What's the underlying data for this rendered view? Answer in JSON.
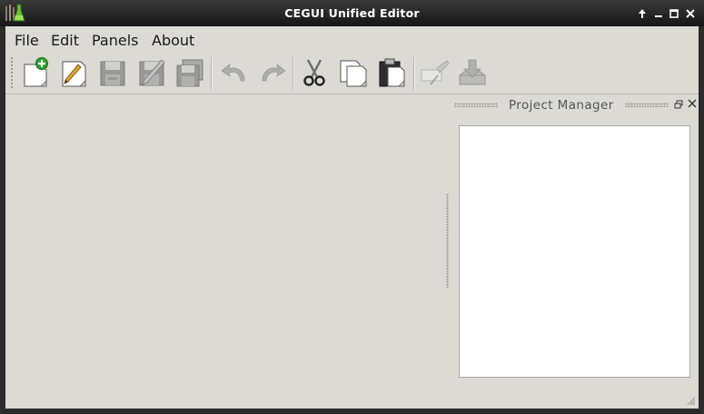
{
  "window": {
    "title": "CEGUI Unified Editor"
  },
  "menubar": {
    "items": [
      "File",
      "Edit",
      "Panels",
      "About"
    ]
  },
  "toolbar": {
    "buttons": [
      {
        "icon": "new-file-icon",
        "enabled": true
      },
      {
        "icon": "edit-document-icon",
        "enabled": true
      },
      {
        "icon": "save-icon",
        "enabled": false
      },
      {
        "icon": "save-as-icon",
        "enabled": false
      },
      {
        "icon": "save-all-icon",
        "enabled": false
      },
      {
        "icon": "undo-icon",
        "enabled": false
      },
      {
        "icon": "redo-icon",
        "enabled": false
      },
      {
        "icon": "cut-icon",
        "enabled": true
      },
      {
        "icon": "copy-icon",
        "enabled": true
      },
      {
        "icon": "paste-icon",
        "enabled": true
      },
      {
        "icon": "project-settings-icon",
        "enabled": false
      },
      {
        "icon": "reload-resources-icon",
        "enabled": false
      }
    ]
  },
  "dock": {
    "title": "Project Manager"
  },
  "colors": {
    "background": "#dcdad5",
    "titlebar": "#161616",
    "panel": "#ffffff",
    "accent_green": "#2ca02c"
  }
}
